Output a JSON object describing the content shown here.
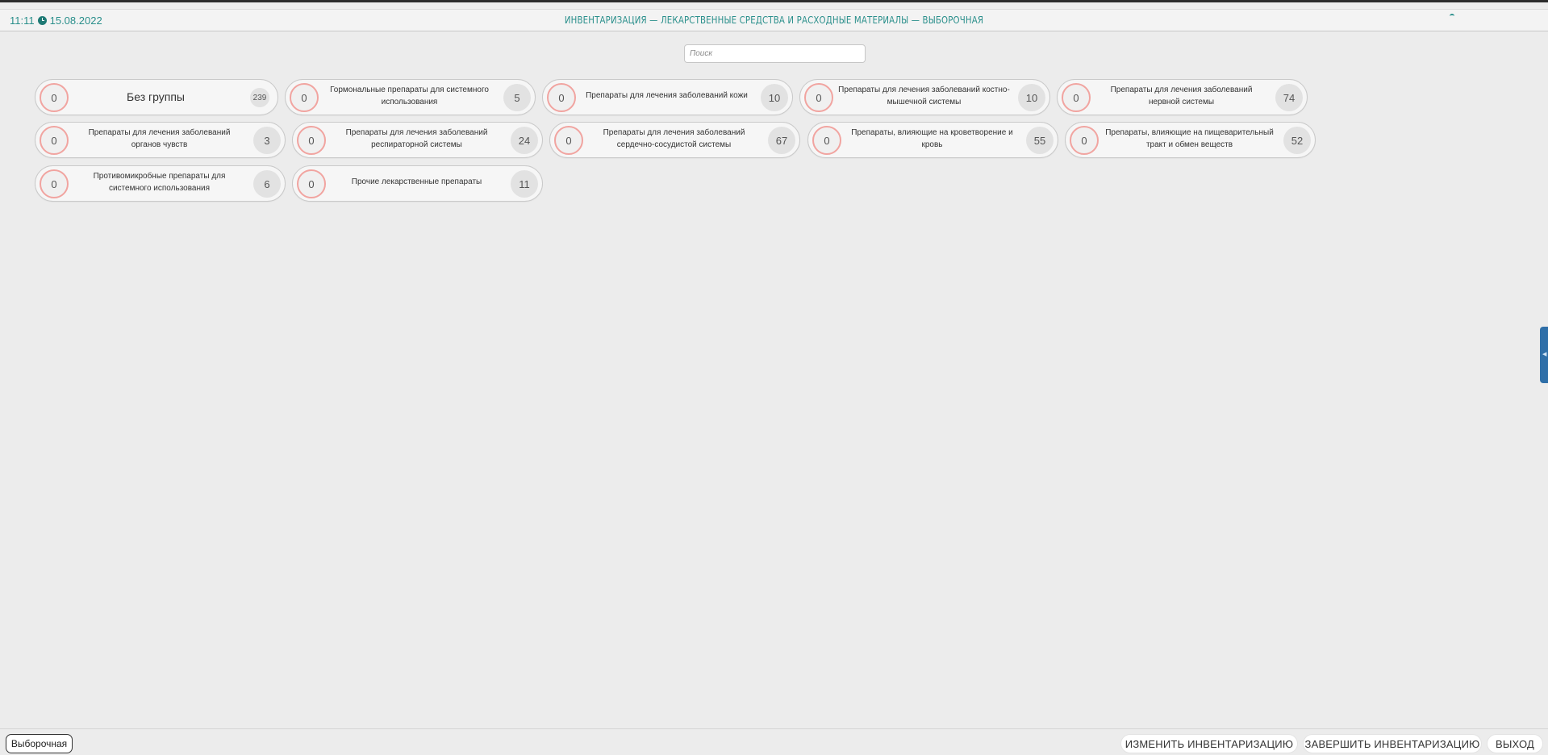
{
  "header": {
    "time": "11:11",
    "date": "15.08.2022",
    "title": "ИНВЕНТАРИЗАЦИЯ — ЛЕКАРСТВЕННЫЕ СРЕДСТВА И РАСХОДНЫЕ МАТЕРИАЛЫ — ВЫБОРОЧНАЯ"
  },
  "search": {
    "placeholder": "Поиск"
  },
  "groups": [
    {
      "counter": "0",
      "label": "Без группы",
      "count": "239"
    },
    {
      "counter": "0",
      "label": "Гормональные препараты для системного использования",
      "count": "5"
    },
    {
      "counter": "0",
      "label": "Препараты для лечения заболеваний кожи",
      "count": "10"
    },
    {
      "counter": "0",
      "label": "Препараты для лечения заболеваний костно-мышечной системы",
      "count": "10"
    },
    {
      "counter": "0",
      "label": "Препараты для лечения заболеваний нервной системы",
      "count": "74"
    },
    {
      "counter": "0",
      "label": "Препараты для лечения заболеваний органов чувств",
      "count": "3"
    },
    {
      "counter": "0",
      "label": "Препараты для лечения заболеваний респираторной системы",
      "count": "24"
    },
    {
      "counter": "0",
      "label": "Препараты для лечения заболеваний сердечно-сосудистой системы",
      "count": "67"
    },
    {
      "counter": "0",
      "label": "Препараты, влияющие на кроветворение и кровь",
      "count": "55"
    },
    {
      "counter": "0",
      "label": "Препараты, влияющие на пищеварительный тракт и обмен веществ",
      "count": "52"
    },
    {
      "counter": "0",
      "label": "Противомикробные препараты для системного использования",
      "count": "6"
    },
    {
      "counter": "0",
      "label": "Прочие лекарственные препараты",
      "count": "11"
    }
  ],
  "footer": {
    "mode": "Выборочная",
    "change": "ИЗМЕНИТЬ ИНВЕНТАРИЗАЦИЮ",
    "finish": "ЗАВЕРШИТЬ ИНВЕНТАРИЗАЦИЮ",
    "exit": "ВЫХОД"
  },
  "colors": {
    "accent": "#2a8f8b",
    "counter_ring": "#f1a4a0",
    "side_tab": "#2f6fa8"
  }
}
